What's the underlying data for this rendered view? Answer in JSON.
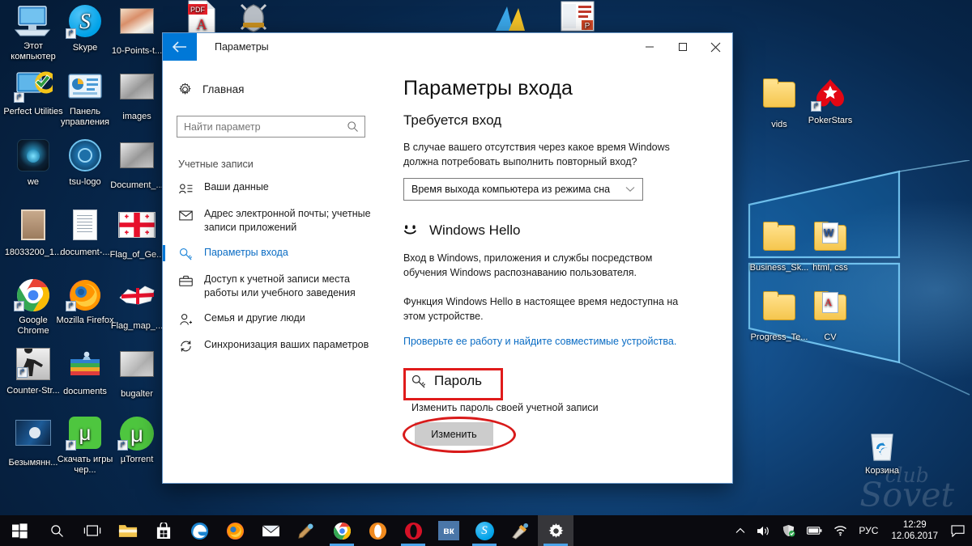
{
  "window": {
    "title": "Параметры",
    "back_icon": "back-arrow-icon",
    "minimize_label": "—",
    "maximize_label": "□",
    "close_label": "✕"
  },
  "sidebar": {
    "home_label": "Главная",
    "home_icon": "gear-icon",
    "search": {
      "placeholder": "Найти параметр",
      "value": "",
      "icon": "search-icon"
    },
    "group_label": "Учетные записи",
    "items": [
      {
        "label": "Ваши данные",
        "icon": "id-card-icon",
        "active": false
      },
      {
        "label": "Адрес электронной почты; учетные записи приложений",
        "icon": "mail-icon",
        "active": false
      },
      {
        "label": "Параметры входа",
        "icon": "key-icon",
        "active": true
      },
      {
        "label": "Доступ к учетной записи места работы или учебного заведения",
        "icon": "briefcase-icon",
        "active": false
      },
      {
        "label": "Семья и другие люди",
        "icon": "person-add-icon",
        "active": false
      },
      {
        "label": "Синхронизация ваших параметров",
        "icon": "sync-icon",
        "active": false
      }
    ]
  },
  "main": {
    "page_title": "Параметры входа",
    "require_signin": {
      "heading": "Требуется вход",
      "description": "В случае вашего отсутствия через какое время Windows должна потребовать выполнить повторный вход?",
      "dropdown_value": "Время выхода компьютера из режима сна",
      "dropdown_chevron": "chevron-down-icon"
    },
    "windows_hello": {
      "heading": "Windows Hello",
      "icon": "hello-face-icon",
      "paragraph1": "Вход в Windows, приложения и службы посредством обучения Windows распознаванию пользователя.",
      "paragraph2": "Функция Windows Hello в настоящее время недоступна на этом устройстве.",
      "link": "Проверьте ее работу и найдите совместимые устройства."
    },
    "password": {
      "heading": "Пароль",
      "icon": "key-icon",
      "description": "Изменить пароль своей учетной записи",
      "button_label": "Изменить",
      "highlight_color": "#e01b1b"
    }
  },
  "desktop": {
    "icons_left": [
      {
        "label": "Этот компьютер",
        "art": "computer",
        "shortcut": false
      },
      {
        "label": "Skype",
        "art": "skype",
        "shortcut": true
      },
      {
        "label": "10-Points-t...",
        "art": "image",
        "shortcut": false
      },
      {
        "label": "Perfect Utilities",
        "art": "perfect",
        "shortcut": true
      },
      {
        "label": "Панель управления",
        "art": "cpanel",
        "shortcut": false
      },
      {
        "label": "images",
        "art": "image",
        "shortcut": false
      },
      {
        "label": "we",
        "art": "we",
        "shortcut": false
      },
      {
        "label": "tsu-logo",
        "art": "tsu",
        "shortcut": false
      },
      {
        "label": "Document_...",
        "art": "image",
        "shortcut": false
      },
      {
        "label": "18033200_1...",
        "art": "photo",
        "shortcut": false
      },
      {
        "label": "document-...",
        "art": "doc",
        "shortcut": false
      },
      {
        "label": "Flag_of_Ge...",
        "art": "flagge",
        "shortcut": false
      },
      {
        "label": "Google Chrome",
        "art": "chrome",
        "shortcut": true
      },
      {
        "label": "Mozilla Firefox",
        "art": "firefox",
        "shortcut": true
      },
      {
        "label": "Flag_map_...",
        "art": "flagmap",
        "shortcut": false
      },
      {
        "label": "Counter-Str...",
        "art": "cs",
        "shortcut": true
      },
      {
        "label": "documents",
        "art": "docstack",
        "shortcut": false
      },
      {
        "label": "bugalter",
        "art": "image",
        "shortcut": false
      },
      {
        "label": "Безымянн...",
        "art": "screenshot",
        "shortcut": false
      },
      {
        "label": "Скачать игры чер...",
        "art": "utorrent-sq",
        "shortcut": true
      },
      {
        "label": "µTorrent",
        "art": "utorrent",
        "shortcut": true
      }
    ],
    "icons_top": [
      {
        "label": "",
        "art": "pdf",
        "shortcut": false
      },
      {
        "label": "",
        "art": "game",
        "shortcut": false
      },
      {
        "label": "",
        "art": "ahk",
        "shortcut": false
      },
      {
        "label": "",
        "art": "ppt",
        "shortcut": false
      }
    ],
    "icons_right": [
      {
        "label": "vids",
        "art": "folder",
        "shortcut": false
      },
      {
        "label": "PokerStars",
        "art": "pokerstars",
        "shortcut": true
      },
      {
        "label": "Business_Sk...",
        "art": "folder",
        "shortcut": false
      },
      {
        "label": "html, css",
        "art": "folder-doc",
        "shortcut": false
      },
      {
        "label": "Progress_Te...",
        "art": "folder",
        "shortcut": false
      },
      {
        "label": "CV",
        "art": "folder-pdf",
        "shortcut": false
      },
      {
        "label": "Корзина",
        "art": "recycle-bin",
        "shortcut": false
      }
    ],
    "watermark_line1": "club",
    "watermark_line2": "Sovet"
  },
  "taskbar": {
    "items": [
      {
        "name": "start-button",
        "art": "start"
      },
      {
        "name": "search-button",
        "art": "search"
      },
      {
        "name": "task-view-button",
        "art": "taskview"
      },
      {
        "name": "file-explorer-button",
        "art": "explorer"
      },
      {
        "name": "store-button",
        "art": "store"
      },
      {
        "name": "edge-button",
        "art": "edge"
      },
      {
        "name": "firefox-button",
        "art": "firefox"
      },
      {
        "name": "mail-button",
        "art": "mail"
      },
      {
        "name": "paint-button",
        "art": "paint2"
      },
      {
        "name": "chrome-button",
        "art": "chrome"
      },
      {
        "name": "opera-gx-button",
        "art": "opera2"
      },
      {
        "name": "opera-button",
        "art": "opera"
      },
      {
        "name": "vk-button",
        "art": "vk"
      },
      {
        "name": "skype-button",
        "art": "skype"
      },
      {
        "name": "paint-net-button",
        "art": "paintnet"
      },
      {
        "name": "settings-button",
        "art": "settings"
      }
    ],
    "tray": {
      "chevron": "∧",
      "volume_icon": "volume-icon",
      "security_icon": "shield-icon",
      "battery_icon": "battery-icon",
      "wifi_icon": "wifi-icon",
      "language": "РУС",
      "time": "12:29",
      "date": "12.06.2017",
      "action_center_icon": "action-center-icon"
    }
  }
}
